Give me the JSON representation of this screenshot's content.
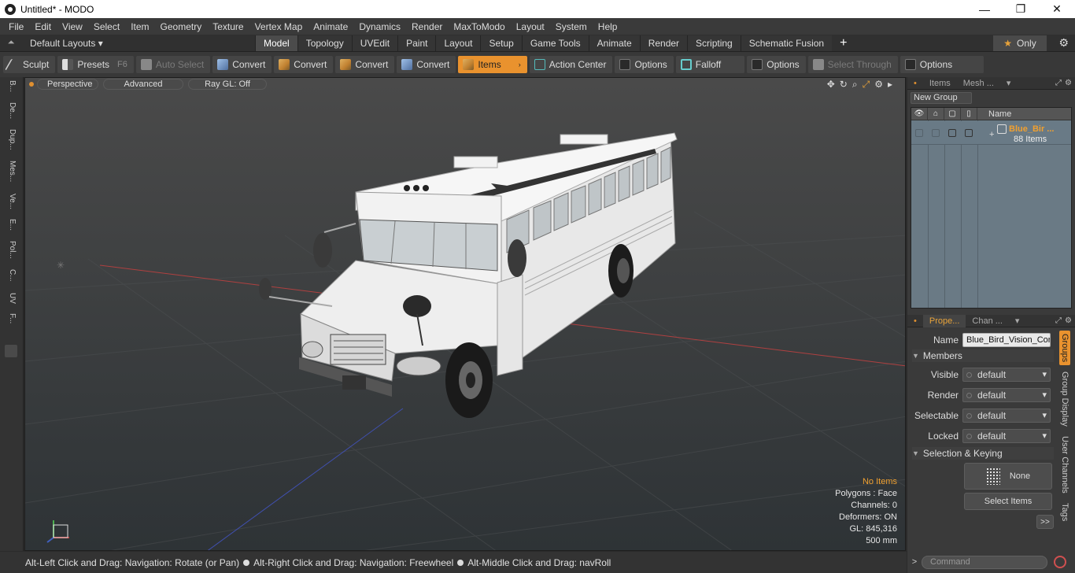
{
  "window": {
    "title": "Untitled* - MODO",
    "controls": [
      "—",
      "❐",
      "✕"
    ]
  },
  "menu": [
    "File",
    "Edit",
    "View",
    "Select",
    "Item",
    "Geometry",
    "Texture",
    "Vertex Map",
    "Animate",
    "Dynamics",
    "Render",
    "MaxToModo",
    "Layout",
    "System",
    "Help"
  ],
  "layoutbar": {
    "layouts_label": "Default Layouts",
    "tabs": [
      "Model",
      "Topology",
      "UVEdit",
      "Paint",
      "Layout",
      "Setup",
      "Game Tools",
      "Animate",
      "Render",
      "Scripting",
      "Schematic Fusion"
    ],
    "active_tab": "Model",
    "only_label": "Only"
  },
  "toolbar": {
    "sculpt": "Sculpt",
    "presets": "Presets",
    "presets_hotkey": "F6",
    "auto_select": "Auto Select",
    "convert": [
      "Convert",
      "Convert",
      "Convert",
      "Convert"
    ],
    "items": "Items",
    "action_center": "Action Center",
    "options1": "Options",
    "falloff": "Falloff",
    "options2": "Options",
    "select_through": "Select Through",
    "options3": "Options"
  },
  "left_tabs": [
    "B...",
    "De...",
    "Dup...",
    "Mes...",
    "Ve...",
    "E...",
    "Pol...",
    "C...",
    "UV",
    "F..."
  ],
  "viewport": {
    "view_mode": "Perspective",
    "shading": "Advanced",
    "raygl": "Ray GL: Off",
    "stats": {
      "no_items": "No Items",
      "polygons": "Polygons : Face",
      "channels": "Channels: 0",
      "deformers": "Deformers: ON",
      "gl": "GL: 845,316",
      "size": "500 mm"
    }
  },
  "statusbar": {
    "hint1": "Alt-Left Click and Drag: Navigation: Rotate (or Pan)",
    "hint2": "Alt-Right Click and Drag: Navigation: Freewheel",
    "hint3": "Alt-Middle Click and Drag: navRoll"
  },
  "items_panel": {
    "tabs": [
      "Items",
      "Mesh ..."
    ],
    "new_group": "New Group",
    "name_header": "Name",
    "group_name": "Blue_Bir ...",
    "group_count": "88 Items"
  },
  "properties": {
    "tabs": [
      "Prope...",
      "Chan ..."
    ],
    "name_label": "Name",
    "name_value": "Blue_Bird_Vision_Cor",
    "members_section": "Members",
    "visible_label": "Visible",
    "visible_value": "default",
    "render_label": "Render",
    "render_value": "default",
    "selectable_label": "Selectable",
    "selectable_value": "default",
    "locked_label": "Locked",
    "locked_value": "default",
    "selection_section": "Selection & Keying",
    "none_label": "None",
    "select_items": "Select Items",
    "more": ">>",
    "side_tabs": [
      "Groups",
      "Group Display",
      "User Channels",
      "Tags"
    ]
  },
  "command": {
    "placeholder": "Command"
  },
  "colors": {
    "accent": "#e9922e",
    "warn_text": "#f0a030",
    "viewport_top": "#4a4a4a",
    "viewport_bottom": "#2e3336"
  }
}
